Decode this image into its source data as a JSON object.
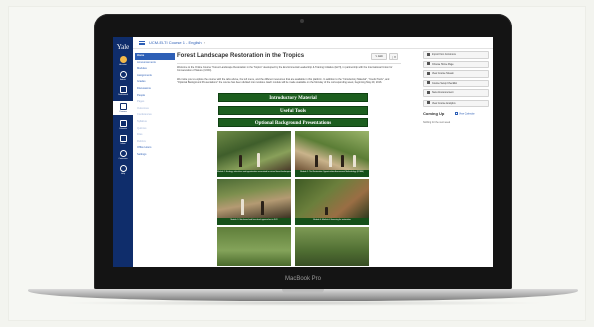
{
  "laptop": {
    "brand": "MacBook Pro"
  },
  "app": {
    "logo": "Yale",
    "global_nav": [
      {
        "label": "Account",
        "icon": "account-icon"
      },
      {
        "label": "Admin",
        "icon": "admin-icon"
      },
      {
        "label": "Dashboard",
        "icon": "dashboard-icon"
      },
      {
        "label": "Courses",
        "icon": "courses-icon",
        "active": true
      },
      {
        "label": "Calendar",
        "icon": "calendar-icon"
      },
      {
        "label": "Inbox",
        "icon": "inbox-icon"
      },
      {
        "label": "Commons",
        "icon": "commons-icon"
      },
      {
        "label": "Help",
        "icon": "help-icon"
      }
    ],
    "breadcrumb": {
      "course": "UCM-ELTI Course 1 - English",
      "separator": "›",
      "current": ""
    },
    "course_nav": [
      {
        "label": "Home",
        "active": true
      },
      {
        "label": "Announcements"
      },
      {
        "label": "Modules"
      },
      {
        "label": "Assignments"
      },
      {
        "label": "Grades"
      },
      {
        "label": "Discussions"
      },
      {
        "label": "People"
      },
      {
        "label": "Pages",
        "muted": true
      },
      {
        "label": "Outcomes",
        "muted": true
      },
      {
        "label": "Conferences",
        "muted": true
      },
      {
        "label": "Syllabus",
        "muted": true
      },
      {
        "label": "Quizzes",
        "muted": true
      },
      {
        "label": "Files",
        "muted": true
      },
      {
        "label": "Rubrics",
        "muted": true
      },
      {
        "label": "Office Hours"
      },
      {
        "label": "Settings"
      }
    ],
    "page": {
      "title": "Forest Landscape Restoration in the Tropics",
      "edit_label": "✎ Edit",
      "more_label": "⋮▾",
      "intro_1": "Welcome to the Online Course \"Forest Landscape Restoration in the Tropics\" developed by the Environmental Leadership & Training Initiative (ELTI), in partnership with the International Union for Conservation of Nature (IUCN).",
      "intro_2": "We invite you to explore the course with the tabs above, the left menu, and the different resources that are available in this platform. In addition to the \"Introductory Material\", \"Useful Tools\", and \"Optional Background Presentations\" the course has been divided into modules. Each module will be made available on the Monday of the corresponding week, beginning May 29, 2016.",
      "sections": [
        "Introductory Material",
        "Useful Tools",
        "Optional Background Presentations"
      ],
      "modules": [
        {
          "caption": "Module 1: Ecology, silviculture and opportunities associated to natural forest landscapes"
        },
        {
          "caption": "Module 2: The Restoration Opportunities Assessment Methodology (ROAM)"
        },
        {
          "caption": "Module 3: Site-based and farm-level approaches to FLR"
        },
        {
          "caption": "Module 4: Markets & financing for restoration"
        },
        {
          "caption": ""
        },
        {
          "caption": ""
        }
      ]
    },
    "sidebar": {
      "buttons": [
        {
          "label": "Import from Commons",
          "icon": "import-icon"
        },
        {
          "label": "Choose Home Page",
          "icon": "home-page-icon"
        },
        {
          "label": "View Course Stream",
          "icon": "stream-icon"
        },
        {
          "label": "Course Setup Checklist",
          "icon": "checklist-icon"
        },
        {
          "label": "New Announcement",
          "icon": "announcement-icon"
        },
        {
          "label": "View Course Analytics",
          "icon": "analytics-icon"
        }
      ],
      "todo_title": "Coming Up",
      "todo_link": "View Calendar",
      "todo_empty": "Nothing for the next week"
    }
  }
}
